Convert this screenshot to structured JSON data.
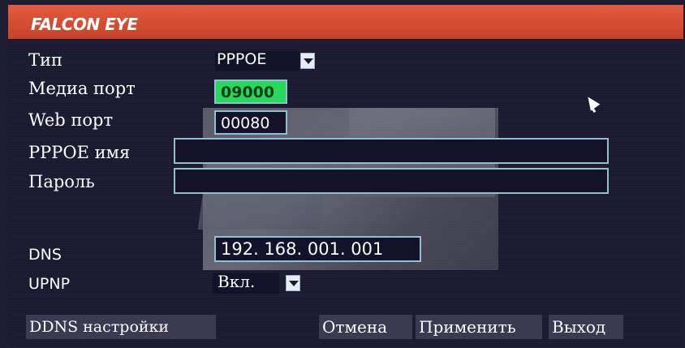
{
  "header": {
    "logo": "FALCON EYE"
  },
  "form": {
    "type_label": "Тип",
    "type_value": "PPPOE",
    "media_port_label": "Медиа порт",
    "media_port_value": "09000",
    "web_port_label": "Web порт",
    "web_port_value": "00080",
    "pppoe_name_label": "PPPOE имя",
    "pppoe_name_value": "",
    "password_label": "Пароль",
    "password_value": "",
    "dns_label": "DNS",
    "dns_value": "192. 168. 001. 001",
    "upnp_label": "UPNP",
    "upnp_value": "Вкл."
  },
  "buttons": {
    "ddns": "DDNS настройки",
    "cancel": "Отмена",
    "apply": "Применить",
    "exit": "Выход"
  },
  "icons": {
    "dropdown": "chevron-down-icon",
    "cursor": "mouse-cursor-icon"
  },
  "colors": {
    "titlebar": "#d94e34",
    "field_border": "#8ec1cf",
    "active_field": "#27d85a",
    "panel_bg": "#1b1a30"
  }
}
